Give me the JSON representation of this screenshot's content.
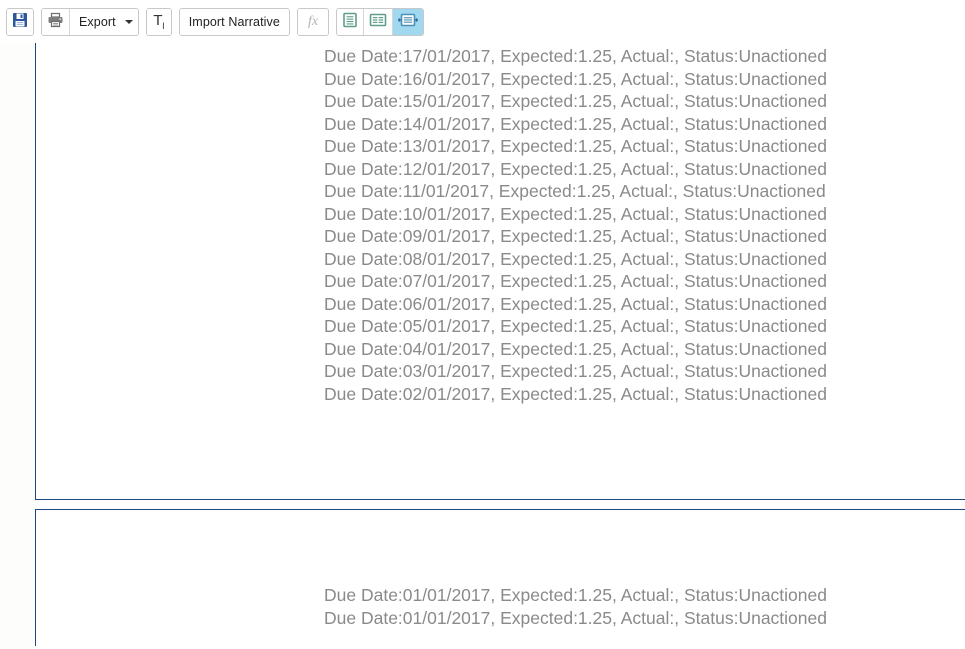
{
  "toolbar": {
    "save": {
      "name": "save-icon",
      "tooltip": "Save"
    },
    "print": {
      "name": "print-icon",
      "tooltip": "Print"
    },
    "export_label": "Export",
    "text_tool": {
      "label": "T",
      "sub": "I"
    },
    "import_narrative_label": "Import Narrative",
    "formula_label": "fx",
    "views": [
      {
        "name": "single-column-view-icon",
        "selected": false
      },
      {
        "name": "two-column-view-icon",
        "selected": false
      },
      {
        "name": "fit-width-view-icon",
        "selected": true
      }
    ]
  },
  "colors": {
    "panel_border": "#1c4a80",
    "text_gray": "#8a8a8a",
    "selected_button": "#9fd8ef",
    "save_icon_blue": "#2b579a"
  },
  "panels": [
    {
      "name": "report-page-1",
      "lines": [
        "Due Date:17/01/2017, Expected:1.25, Actual:, Status:Unactioned",
        "Due Date:16/01/2017, Expected:1.25, Actual:, Status:Unactioned",
        "Due Date:15/01/2017, Expected:1.25, Actual:, Status:Unactioned",
        "Due Date:14/01/2017, Expected:1.25, Actual:, Status:Unactioned",
        "Due Date:13/01/2017, Expected:1.25, Actual:, Status:Unactioned",
        "Due Date:12/01/2017, Expected:1.25, Actual:, Status:Unactioned",
        "Due Date:11/01/2017, Expected:1.25, Actual:, Status:Unactioned",
        "Due Date:10/01/2017, Expected:1.25, Actual:, Status:Unactioned",
        "Due Date:09/01/2017, Expected:1.25, Actual:, Status:Unactioned",
        "Due Date:08/01/2017, Expected:1.25, Actual:, Status:Unactioned",
        "Due Date:07/01/2017, Expected:1.25, Actual:, Status:Unactioned",
        "Due Date:06/01/2017, Expected:1.25, Actual:, Status:Unactioned",
        "Due Date:05/01/2017, Expected:1.25, Actual:, Status:Unactioned",
        "Due Date:04/01/2017, Expected:1.25, Actual:, Status:Unactioned",
        "Due Date:03/01/2017, Expected:1.25, Actual:, Status:Unactioned",
        "Due Date:02/01/2017, Expected:1.25, Actual:, Status:Unactioned"
      ]
    },
    {
      "name": "report-page-2",
      "lines": [
        "Due Date:01/01/2017, Expected:1.25, Actual:, Status:Unactioned",
        "Due Date:01/01/2017, Expected:1.25, Actual:, Status:Unactioned"
      ]
    }
  ]
}
